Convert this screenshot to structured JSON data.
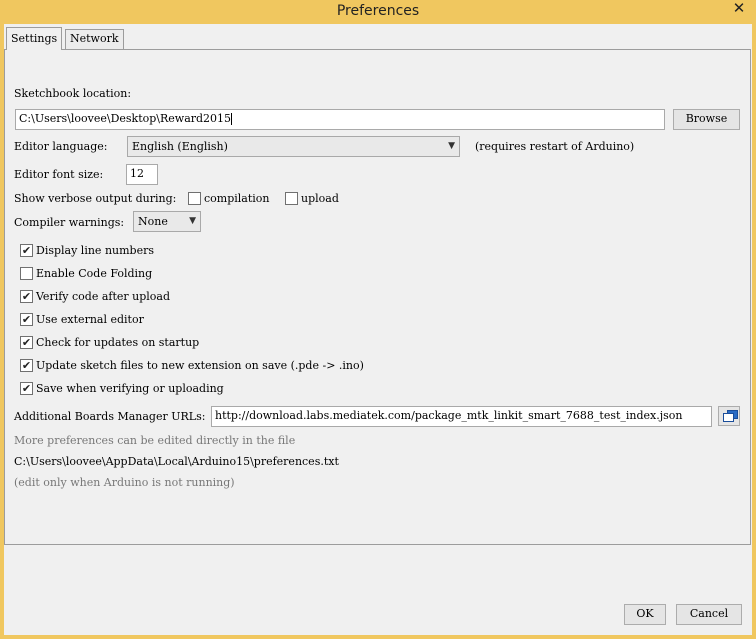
{
  "window": {
    "title": "Preferences",
    "close_symbol": "✕"
  },
  "tabs": [
    {
      "label": "Settings",
      "active": true
    },
    {
      "label": "Network",
      "active": false
    }
  ],
  "sketchbook": {
    "label": "Sketchbook location:",
    "value": "C:\\Users\\loovee\\Desktop\\Reward2015",
    "browse_label": "Browse"
  },
  "language": {
    "label": "Editor language:",
    "selected": "English (English)",
    "note": "(requires restart of Arduino)"
  },
  "font_size": {
    "label": "Editor font size:",
    "value": "12"
  },
  "verbose": {
    "label": "Show verbose output during:",
    "compilation_label": "compilation",
    "compilation_checked": false,
    "upload_label": "upload",
    "upload_checked": false
  },
  "warnings": {
    "label": "Compiler warnings:",
    "selected": "None"
  },
  "options": [
    {
      "label": "Display line numbers",
      "checked": true
    },
    {
      "label": "Enable Code Folding",
      "checked": false
    },
    {
      "label": "Verify code after upload",
      "checked": true
    },
    {
      "label": "Use external editor",
      "checked": true
    },
    {
      "label": "Check for updates on startup",
      "checked": true
    },
    {
      "label": "Update sketch files to new extension on save (.pde -> .ino)",
      "checked": true
    },
    {
      "label": "Save when verifying or uploading",
      "checked": true
    }
  ],
  "boards_manager": {
    "label": "Additional Boards Manager URLs:",
    "value": "http://download.labs.mediatek.com/package_mtk_linkit_smart_7688_test_index.json",
    "icon": "window-icon"
  },
  "info": {
    "more_text": "More preferences can be edited directly in the file",
    "path": "C:\\Users\\loovee\\AppData\\Local\\Arduino15\\preferences.txt",
    "note": "(edit only when Arduino is not running)"
  },
  "footer": {
    "ok_label": "OK",
    "cancel_label": "Cancel"
  },
  "colors": {
    "title_bar": "#f0c75f",
    "client": "#f0f0f0"
  }
}
